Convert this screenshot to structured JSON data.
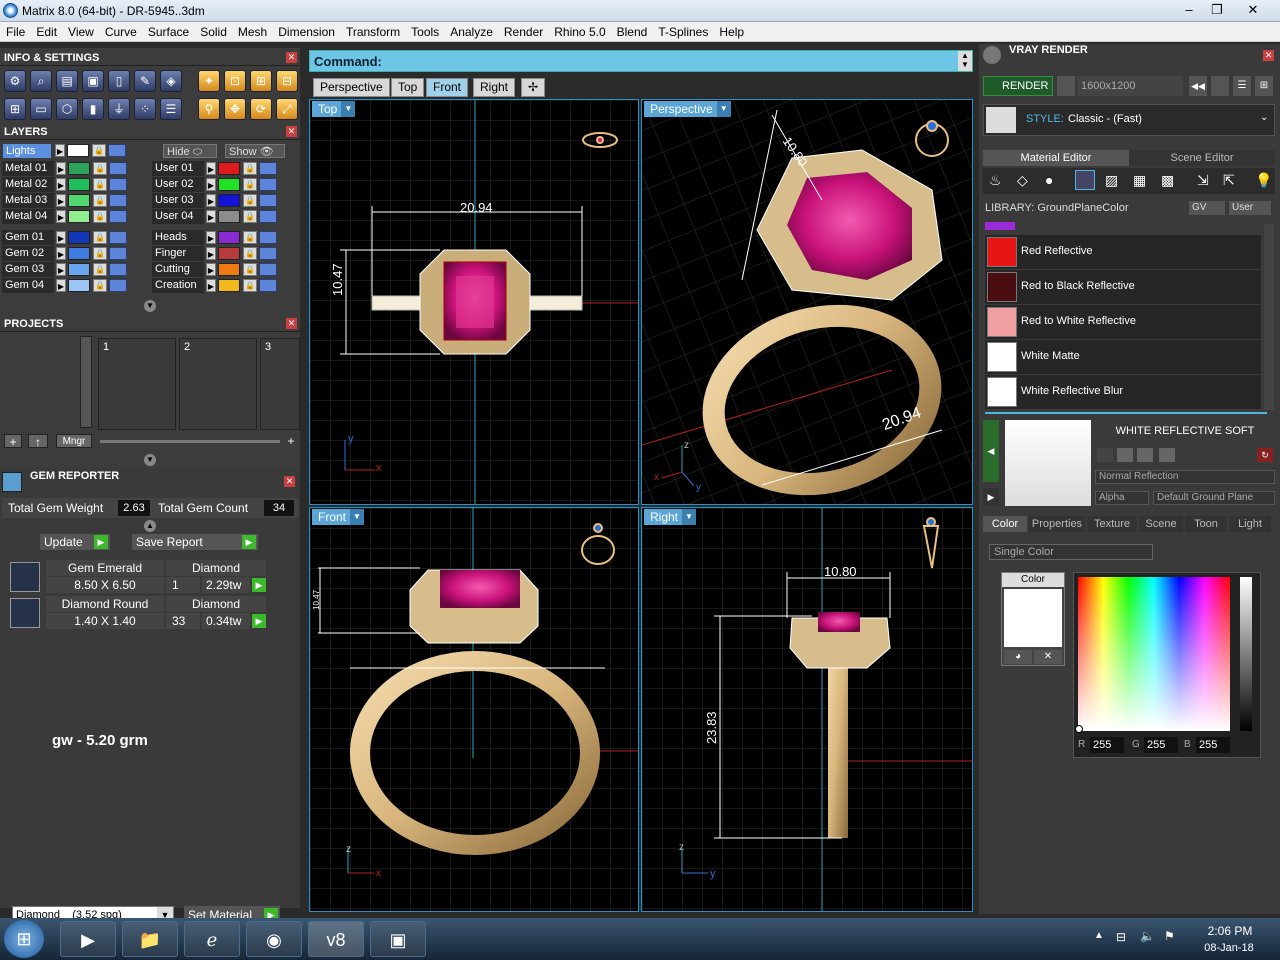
{
  "window": {
    "title": "Matrix 8.0 (64-bit) - DR-5945..3dm"
  },
  "menu": [
    "File",
    "Edit",
    "View",
    "Curve",
    "Surface",
    "Solid",
    "Mesh",
    "Dimension",
    "Transform",
    "Tools",
    "Analyze",
    "Render",
    "Rhino 5.0",
    "Blend",
    "T-Splines",
    "Help"
  ],
  "info_settings": {
    "title": "INFO & SETTINGS"
  },
  "layers": {
    "title": "LAYERS",
    "lights_label": "Lights",
    "hide_label": "Hide",
    "show_label": "Show",
    "left": [
      {
        "name": "Metal 01",
        "color": "#2ea35a"
      },
      {
        "name": "Metal 02",
        "color": "#1fbf5c"
      },
      {
        "name": "Metal 03",
        "color": "#52d86e"
      },
      {
        "name": "Metal 04",
        "color": "#92ee8c"
      },
      {
        "name": "Gem 01",
        "color": "#1236b8"
      },
      {
        "name": "Gem 02",
        "color": "#3f7be0"
      },
      {
        "name": "Gem 03",
        "color": "#6aa5f0"
      },
      {
        "name": "Gem 04",
        "color": "#9cc5f7"
      }
    ],
    "right": [
      {
        "name": "User 01",
        "color": "#e01a1a"
      },
      {
        "name": "User 02",
        "color": "#22e022"
      },
      {
        "name": "User 03",
        "color": "#1212d8"
      },
      {
        "name": "User 04",
        "color": "#8c8c8c"
      },
      {
        "name": "Heads",
        "color": "#8a2ad0"
      },
      {
        "name": "Finger",
        "color": "#b83a3a"
      },
      {
        "name": "Cutting",
        "color": "#f07a12"
      },
      {
        "name": "Creation",
        "color": "#f2b81c"
      }
    ]
  },
  "projects": {
    "title": "PROJECTS",
    "slots": [
      "1",
      "2",
      "3"
    ],
    "mngr_label": "Mngr"
  },
  "gem_reporter": {
    "title": "GEM REPORTER",
    "weight_label": "Total Gem Weight",
    "weight_value": "2.63",
    "count_label": "Total Gem Count",
    "count_value": "34",
    "update_label": "Update",
    "save_label": "Save Report",
    "gems": [
      {
        "name": "Gem Emerald",
        "type": "Diamond",
        "size": "8.50 X 6.50",
        "qty": "1",
        "tw": "2.29tw"
      },
      {
        "name": "Diamond Round",
        "type": "Diamond",
        "size": "1.40 X 1.40",
        "qty": "33",
        "tw": "0.34tw"
      }
    ],
    "note": "gw - 5.20 grm",
    "material_select": "Diamond    (3.52 spg)",
    "set_material_label": "Set Material"
  },
  "command": {
    "label": "Command:"
  },
  "viewport_tabs": [
    "Perspective",
    "Top",
    "Front",
    "Right"
  ],
  "active_tab": "Front",
  "viewports": {
    "top": {
      "label": "Top",
      "dim_width": "20.94",
      "dim_height": "10.47"
    },
    "perspective": {
      "label": "Perspective",
      "dim_a": "10.80",
      "dim_b": "20.94"
    },
    "front": {
      "label": "Front",
      "dim_small": "10.47"
    },
    "right": {
      "label": "Right",
      "dim_width": "10.80",
      "dim_height": "23.83"
    }
  },
  "vray": {
    "title": "VRAY RENDER",
    "render_label": "RENDER",
    "resolution": "1600x1200",
    "style_label": "STYLE:",
    "style_value": "Classic - (Fast)",
    "tab_material": "Material Editor",
    "tab_scene": "Scene Editor",
    "library_label": "LIBRARY: GroundPlaneColor",
    "gv_label": "GV",
    "user_label": "User",
    "materials": [
      {
        "name": "Red Reflective",
        "color": "#e81515"
      },
      {
        "name": "Red to Black Reflective",
        "color": "#4a0e10"
      },
      {
        "name": "Red to White Reflective",
        "color": "#f0a0a0"
      },
      {
        "name": "White Matte",
        "color": "#ffffff"
      },
      {
        "name": "White Reflective Blur",
        "color": "#ffffff"
      }
    ],
    "selected_material": "WHITE REFLECTIVE SOFT",
    "reflection_mode": "Normal Reflection",
    "alpha_label": "Alpha",
    "ground_plane": "Default Ground Plane",
    "prop_tabs": [
      "Color",
      "Properties",
      "Texture",
      "Scene",
      "Toon",
      "Light"
    ],
    "color_mode": "Single Color",
    "color_box_label": "Color",
    "rgb": {
      "r_label": "R",
      "r": "255",
      "g_label": "G",
      "g": "255",
      "b_label": "B",
      "b": "255"
    }
  },
  "taskbar": {
    "time": "2:06 PM",
    "date": "08-Jan-18"
  },
  "colors": {
    "accent": "#6ec6e6",
    "viewport_border": "#2a8fc5",
    "gold": "#e3c48e",
    "ruby": "#d2187c"
  }
}
